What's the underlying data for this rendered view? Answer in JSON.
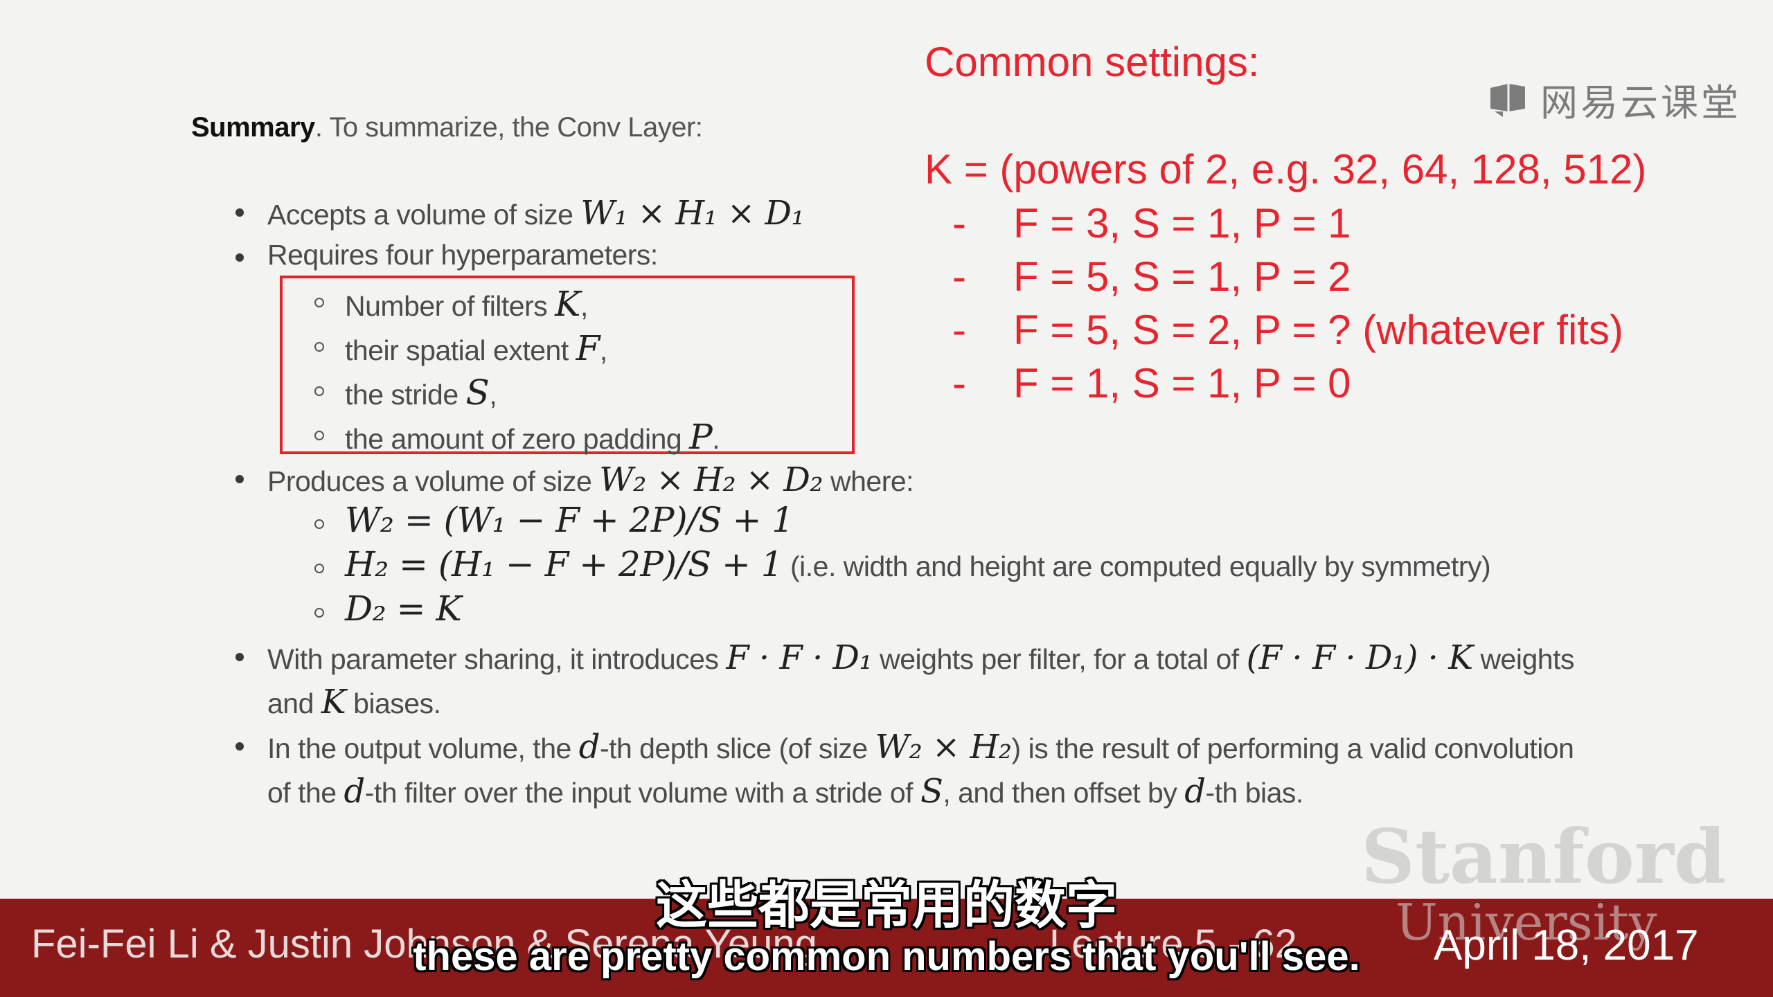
{
  "summary": {
    "bold": "Summary",
    "rest": ". To summarize, the Conv Layer:",
    "b1_text": "Accepts a volume of size ",
    "b1_math": "W₁ × H₁ × D₁",
    "b2_text": "Requires four hyperparameters:",
    "h1_text": "Number of filters ",
    "h1_math": "K",
    "h1_end": ",",
    "h2_text": "their spatial extent ",
    "h2_math": "F",
    "h2_end": ",",
    "h3_text": "the stride ",
    "h3_math": "S",
    "h3_end": ",",
    "h4_text": "the amount of zero padding ",
    "h4_math": "P",
    "h4_end": ".",
    "b3_text": "Produces a volume of size ",
    "b3_math": "W₂ × H₂ × D₂",
    "b3_end": " where:",
    "e1": "W₂ = (W₁ − F + 2P)/S + 1",
    "e2": "H₂ = (H₁ − F + 2P)/S + 1",
    "e2_note": " (i.e. width and height are computed equally by symmetry)",
    "e3": "D₂ = K",
    "b4_l1a": "With parameter sharing, it introduces ",
    "b4_m1": "F · F · D₁",
    "b4_l1b": " weights per filter, for a total of ",
    "b4_m2": "(F · F · D₁) · K",
    "b4_l1c": " weights",
    "b4_l2a": "and ",
    "b4_m3": "K",
    "b4_l2b": " biases.",
    "b5_l1a": "In the output volume, the ",
    "b5_m1": "d",
    "b5_l1b": "-th depth slice (of size ",
    "b5_m2": "W₂ × H₂",
    "b5_l1c": ") is the result of performing a valid convolution",
    "b5_l2a": "of the ",
    "b5_m3": "d",
    "b5_l2b": "-th filter over the input volume with a stride of ",
    "b5_m4": "S",
    "b5_l2c": ", and then offset by ",
    "b5_m5": "d",
    "b5_l2d": "-th bias."
  },
  "common": {
    "title": "Common settings:",
    "k_line": "K = (powers of 2, e.g. 32, 64, 128, 512)",
    "dash": "-",
    "r1": "F = 3, S = 1, P = 1",
    "r2": "F = 5, S = 1, P = 2",
    "r3": "F = 5, S = 2, P = ? (whatever fits)",
    "r4": "F = 1, S = 1, P = 0"
  },
  "watermark": {
    "logo_text": "网易云课堂"
  },
  "branding": {
    "stanford": "Stanford",
    "university": "University"
  },
  "footer": {
    "authors": "Fei-Fei Li & Justin Johnson & Serena Yeung",
    "lecture": "Lecture 5 - 62",
    "date": "April 18, 2017"
  },
  "subtitles": {
    "cn": "这些都是常用的数字",
    "en": "these are pretty common numbers that you'll see."
  },
  "colors": {
    "accent_red": "#e8252e",
    "footer_bg": "#8a1a1a",
    "box_red": "#e0242e"
  }
}
